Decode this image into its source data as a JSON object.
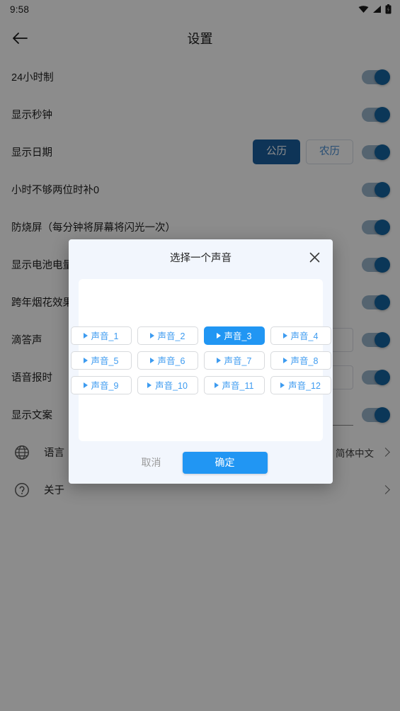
{
  "status_bar": {
    "time": "9:58",
    "icons": [
      "wifi-icon",
      "signal-icon",
      "battery-charging-icon"
    ]
  },
  "app_bar": {
    "back_icon": "arrow-left-icon",
    "title": "设置"
  },
  "settings": {
    "rows": [
      {
        "label": "24小时制",
        "control": "toggle",
        "toggle_on": true
      },
      {
        "label": "显示秒钟",
        "control": "toggle",
        "toggle_on": true
      },
      {
        "label": "显示日期",
        "control": "segmented-toggle",
        "toggle_on": true,
        "options": [
          {
            "label": "公历",
            "selected": true
          },
          {
            "label": "农历",
            "selected": false
          }
        ]
      },
      {
        "label": "小时不够两位时补0",
        "control": "toggle",
        "toggle_on": true
      },
      {
        "label": "防烧屏（每分钟将屏幕将闪光一次）",
        "control": "toggle",
        "toggle_on": true
      },
      {
        "label": "显示电池电量",
        "control": "toggle",
        "toggle_on": true
      },
      {
        "label": "跨年烟花效果",
        "control": "toggle",
        "toggle_on": true
      },
      {
        "label": "滴答声",
        "control": "field-toggle",
        "toggle_on": true
      },
      {
        "label": "语音报时",
        "control": "field-toggle",
        "toggle_on": true
      },
      {
        "label": "显示文案",
        "control": "underline-toggle",
        "toggle_on": true
      }
    ],
    "nav_rows": [
      {
        "icon": "globe-icon",
        "label": "语言",
        "value": "简体中文",
        "chevron": "chevron-right-icon"
      },
      {
        "icon": "help-circle-icon",
        "label": "关于",
        "value": "",
        "chevron": "chevron-right-icon"
      }
    ]
  },
  "dialog": {
    "title": "选择一个声音",
    "close_icon": "close-icon",
    "sounds": [
      {
        "label": "声音_1",
        "selected": false
      },
      {
        "label": "声音_2",
        "selected": false
      },
      {
        "label": "声音_3",
        "selected": true
      },
      {
        "label": "声音_4",
        "selected": false
      },
      {
        "label": "声音_5",
        "selected": false
      },
      {
        "label": "声音_6",
        "selected": false
      },
      {
        "label": "声音_7",
        "selected": false
      },
      {
        "label": "声音_8",
        "selected": false
      },
      {
        "label": "声音_9",
        "selected": false
      },
      {
        "label": "声音_10",
        "selected": false
      },
      {
        "label": "声音_11",
        "selected": false
      },
      {
        "label": "声音_12",
        "selected": false
      }
    ],
    "cancel_label": "取消",
    "confirm_label": "确定"
  },
  "colors": {
    "accent_blue": "#2196f3",
    "link_blue": "#3d9bf0",
    "toggle_thumb": "#1565a0",
    "toggle_track": "#9cb6cc",
    "segment_selected": "#1a5f9e",
    "dialog_bg": "#f2f6fd",
    "scrim": "rgba(0,0,0,0.45)"
  }
}
